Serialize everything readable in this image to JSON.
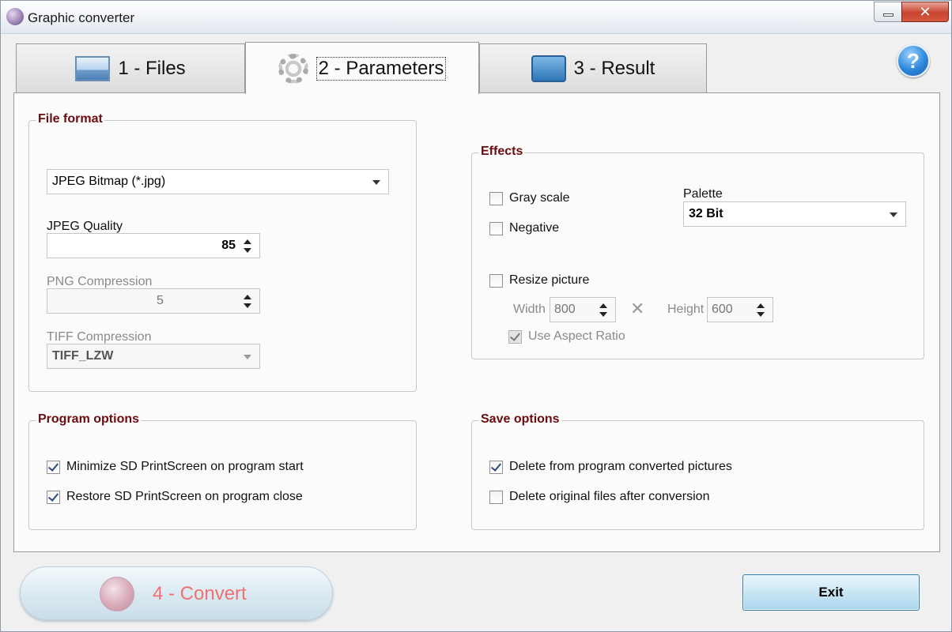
{
  "window": {
    "title": "Graphic converter",
    "close_glyph": "✕"
  },
  "tabs": [
    {
      "label": "1 - Files",
      "icon": "picture-icon"
    },
    {
      "label": "2 - Parameters",
      "icon": "gear-icon"
    },
    {
      "label": "3 - Result",
      "icon": "result-icon"
    }
  ],
  "help_glyph": "?",
  "file_format": {
    "title": "File format",
    "format_value": "JPEG Bitmap (*.jpg)",
    "jpeg_quality_label": "JPEG Quality",
    "jpeg_quality_value": "85",
    "png_label": "PNG Compression",
    "png_value": "5",
    "tiff_label": "TIFF Compression",
    "tiff_value": "TIFF_LZW"
  },
  "effects": {
    "title": "Effects",
    "gray_scale": "Gray scale",
    "negative": "Negative",
    "palette_label": "Palette",
    "palette_value": "32 Bit",
    "resize": "Resize picture",
    "width_label": "Width",
    "width_value": "800",
    "times_glyph": "✕",
    "height_label": "Height",
    "height_value": "600",
    "aspect_ratio": "Use Aspect Ratio"
  },
  "program_options": {
    "title": "Program options",
    "minimize": "Minimize SD PrintScreen on program start",
    "restore": "Restore SD PrintScreen on program close"
  },
  "save_options": {
    "title": "Save options",
    "delete_converted": "Delete from program converted pictures",
    "delete_original": "Delete original files after conversion"
  },
  "buttons": {
    "convert": "4 - Convert",
    "exit": "Exit"
  },
  "colors": {
    "group_title": "#6b0d10",
    "convert_text": "#f07070",
    "close_button": "#c9452f"
  }
}
